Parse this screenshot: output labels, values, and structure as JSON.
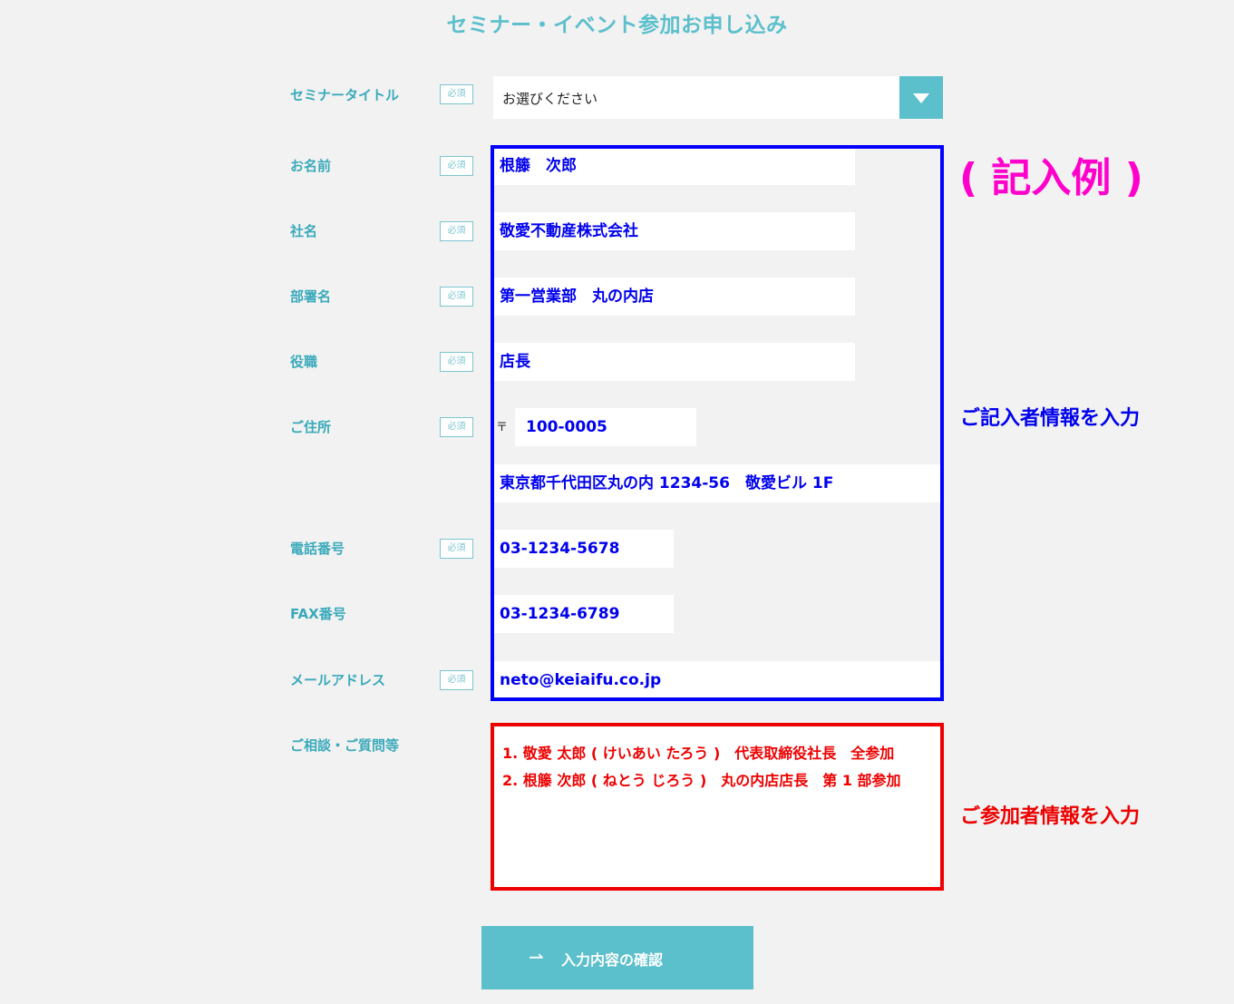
{
  "page_title": "セミナー・イベント参加お申し込み",
  "required_badge": "必須",
  "labels": {
    "seminar_title": "セミナータイトル",
    "name": "お名前",
    "company": "社名",
    "department": "部署名",
    "position": "役職",
    "address": "ご住所",
    "phone": "電話番号",
    "fax": "FAX番号",
    "email": "メールアドレス",
    "inquiry": "ご相談・ご質問等"
  },
  "seminar_select": {
    "value": "お選びください"
  },
  "fields": {
    "name": "根籐　次郎",
    "company": "敬愛不動産株式会社",
    "department": "第一営業部　丸の内店",
    "position": "店長",
    "postal_mark": "〒",
    "postal_code": "100-0005",
    "address": "東京都千代田区丸の内 1234-56　敬愛ビル 1F",
    "phone": "03-1234-5678",
    "fax": "03-1234-6789",
    "email": "neto@keiaifu.co.jp"
  },
  "inquiry_lines": [
    "1. 敬愛 太郎 ( けいあい たろう )　代表取締役社長　全参加",
    "2. 根籐 次郎 ( ねとう じろう )　丸の内店店長　第 1 部参加"
  ],
  "annotations": {
    "example": "( 記入例 )",
    "entrant_info": "ご記入者情報を入力",
    "participant_info": "ご参加者情報を入力"
  },
  "submit": {
    "arrow": "⇀",
    "label": "入力内容の確認"
  },
  "colors": {
    "accent": "#5cbfcc",
    "example_pink": "#ff00cc",
    "annotation_blue": "#0000ff",
    "annotation_red": "#ee0000"
  }
}
